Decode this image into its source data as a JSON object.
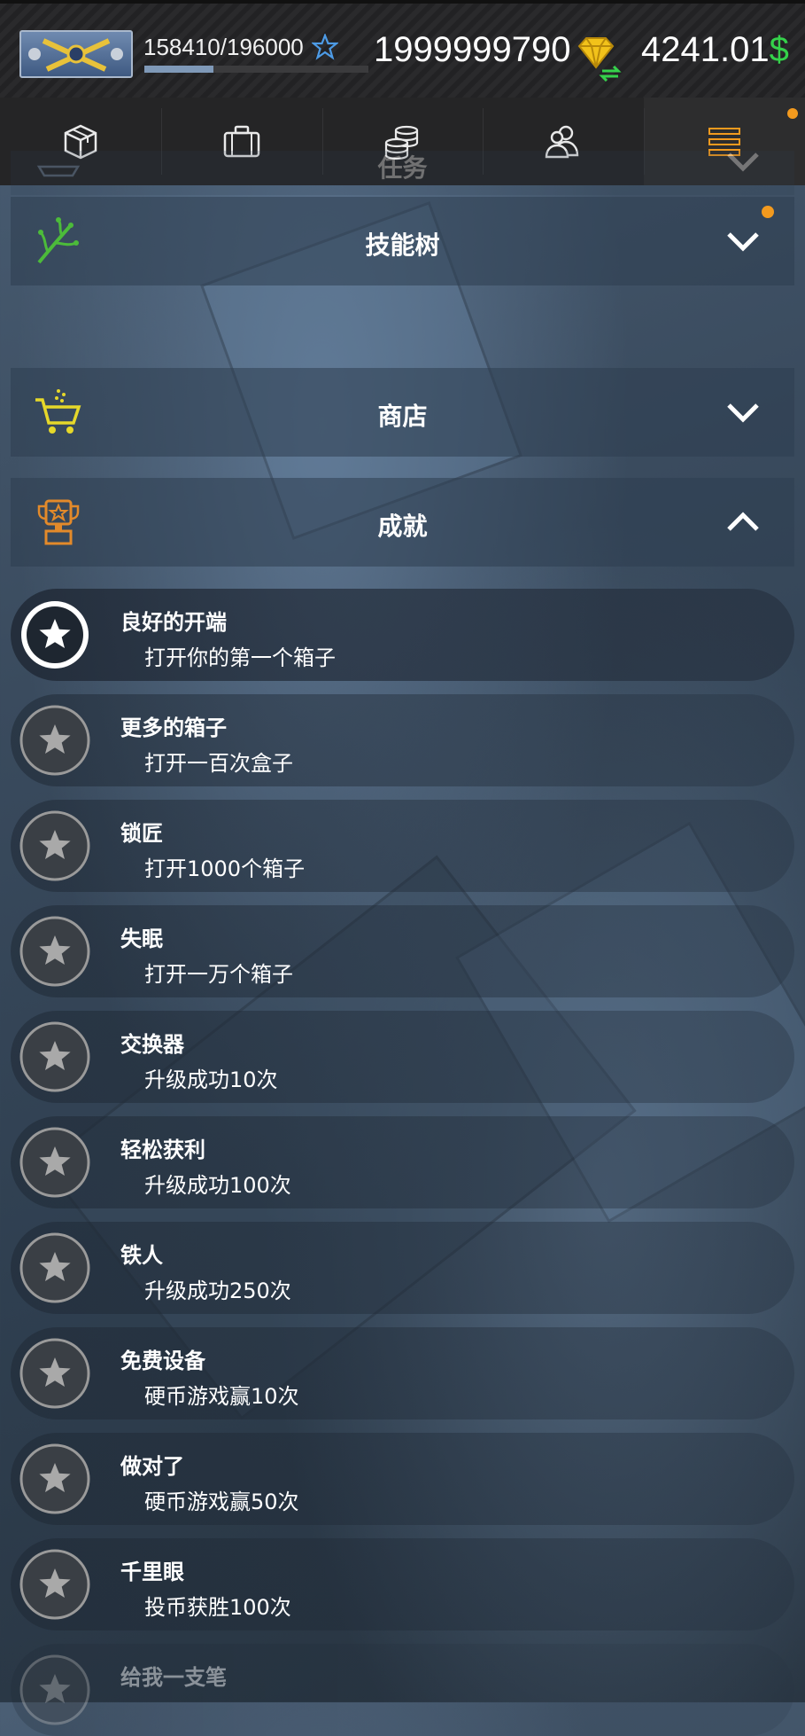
{
  "header": {
    "xp": "158410/196000",
    "xp_progress": 0.31,
    "diamonds": "1999999790",
    "cash": "4241.01",
    "cash_symbol": "$"
  },
  "nav": {
    "tabs": [
      {
        "icon": "crate-icon"
      },
      {
        "icon": "briefcase-icon"
      },
      {
        "icon": "coins-icon"
      },
      {
        "icon": "friends-icon"
      },
      {
        "icon": "menu-icon",
        "active": true,
        "notification": true
      }
    ]
  },
  "sections": [
    {
      "title": "任务",
      "icon": "ship-icon",
      "expanded": false
    },
    {
      "title": "技能树",
      "icon": "skill-tree-icon",
      "expanded": false,
      "notification": true
    },
    {
      "title": "商店",
      "icon": "shopping-cart-icon",
      "expanded": false
    },
    {
      "title": "成就",
      "icon": "trophy-icon",
      "expanded": true
    }
  ],
  "achievements": [
    {
      "title": "良好的开端",
      "desc": "打开你的第一个箱子",
      "unlocked": true
    },
    {
      "title": "更多的箱子",
      "desc": "打开一百次盒子",
      "unlocked": false
    },
    {
      "title": "锁匠",
      "desc": "打开1000个箱子",
      "unlocked": false
    },
    {
      "title": "失眠",
      "desc": "打开一万个箱子",
      "unlocked": false
    },
    {
      "title": "交换器",
      "desc": "升级成功10次",
      "unlocked": false
    },
    {
      "title": "轻松获利",
      "desc": "升级成功100次",
      "unlocked": false
    },
    {
      "title": "铁人",
      "desc": "升级成功250次",
      "unlocked": false
    },
    {
      "title": "免费设备",
      "desc": "硬币游戏赢10次",
      "unlocked": false
    },
    {
      "title": "做对了",
      "desc": "硬币游戏赢50次",
      "unlocked": false
    },
    {
      "title": "千里眼",
      "desc": "投币获胜100次",
      "unlocked": false
    },
    {
      "title": "给我一支笔",
      "desc": "",
      "unlocked": false
    }
  ],
  "colors": {
    "accent_orange": "#f39a1e",
    "cash_green": "#35d24b",
    "diamond_gold": "#f2c21a",
    "skill_green": "#4cbb3a",
    "shop_yellow": "#e6d82a",
    "trophy_orange": "#e38a2a"
  }
}
